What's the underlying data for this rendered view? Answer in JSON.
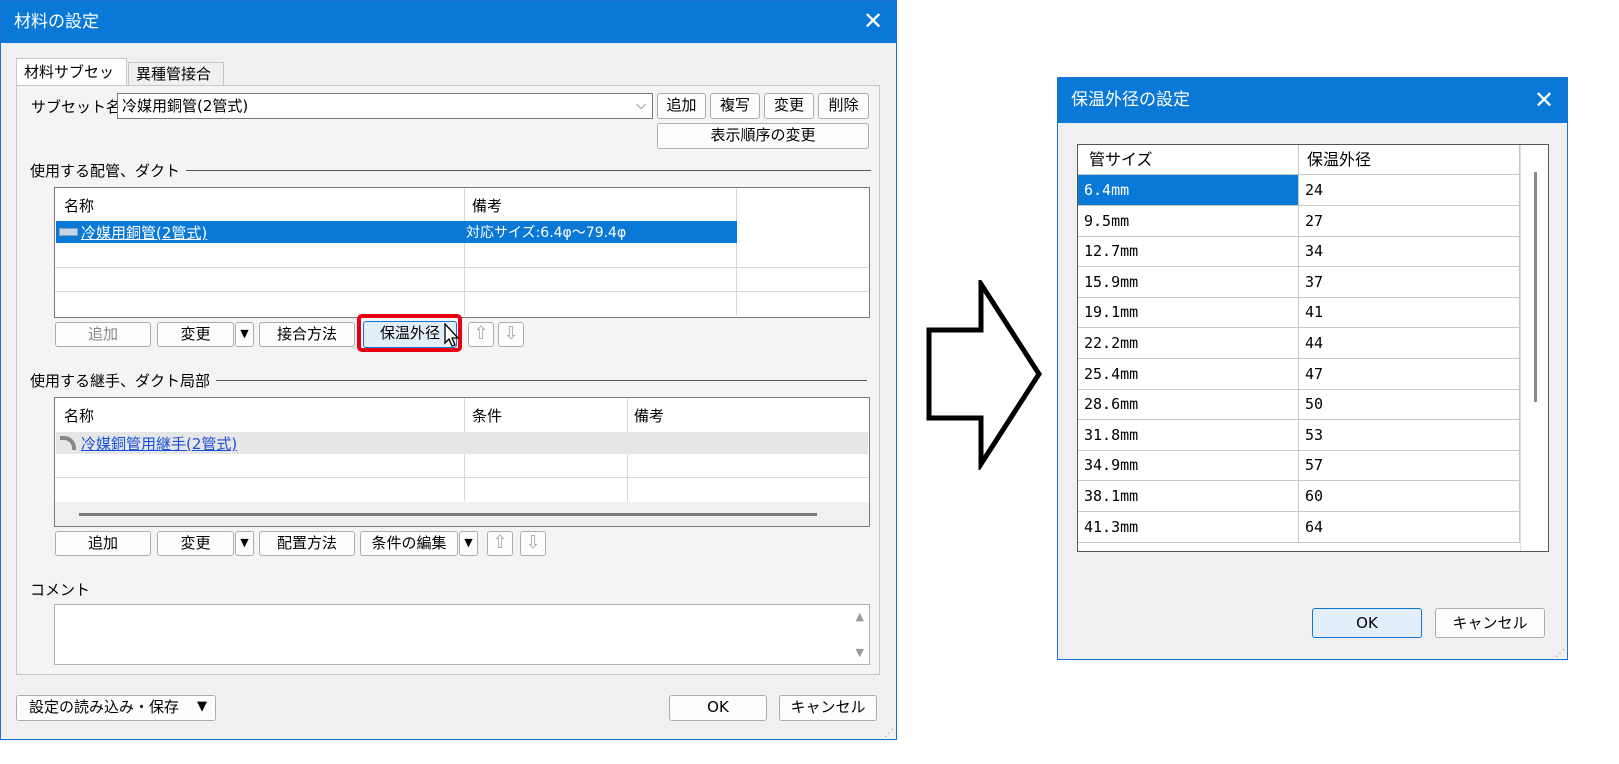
{
  "left_dialog": {
    "title": "材料の設定",
    "tabs": [
      "材料サブセット",
      "異種管接合"
    ],
    "subset_label": "サブセット名",
    "subset_value": "冷媒用銅管(2管式)",
    "subset_buttons": [
      "追加",
      "複写",
      "変更",
      "削除"
    ],
    "reorder_button": "表示順序の変更",
    "pipe_section": {
      "label": "使用する配管、ダクト",
      "headers": [
        "名称",
        "備考"
      ],
      "rows": [
        {
          "name": "冷媒用銅管(2管式)",
          "note": "対応サイズ:6.4φ～79.4φ"
        }
      ],
      "buttons": {
        "add": "追加",
        "change": "変更",
        "connect": "接合方法",
        "insulation": "保温外径"
      }
    },
    "fitting_section": {
      "label": "使用する継手、ダクト局部",
      "headers": [
        "名称",
        "条件",
        "備考"
      ],
      "rows": [
        {
          "name": "冷媒銅管用継手(2管式)"
        }
      ],
      "buttons": {
        "add": "追加",
        "change": "変更",
        "place": "配置方法",
        "edit": "条件の編集"
      }
    },
    "comment_label": "コメント",
    "load_save": "設定の読み込み・保存",
    "ok": "OK",
    "cancel": "キャンセル"
  },
  "right_dialog": {
    "title": "保温外径の設定",
    "headers": [
      "管サイズ",
      "保温外径"
    ],
    "rows": [
      [
        "6.4mm",
        "24"
      ],
      [
        "9.5mm",
        "27"
      ],
      [
        "12.7mm",
        "34"
      ],
      [
        "15.9mm",
        "37"
      ],
      [
        "19.1mm",
        "41"
      ],
      [
        "22.2mm",
        "44"
      ],
      [
        "25.4mm",
        "47"
      ],
      [
        "28.6mm",
        "50"
      ],
      [
        "31.8mm",
        "53"
      ],
      [
        "34.9mm",
        "57"
      ],
      [
        "38.1mm",
        "60"
      ],
      [
        "41.3mm",
        "64"
      ]
    ],
    "ok": "OK",
    "cancel": "キャンセル"
  },
  "colors": {
    "title_bar": "#0a78d7",
    "highlight": "#e60012",
    "selection": "#0a78d7",
    "link": "#1a4fd8"
  }
}
